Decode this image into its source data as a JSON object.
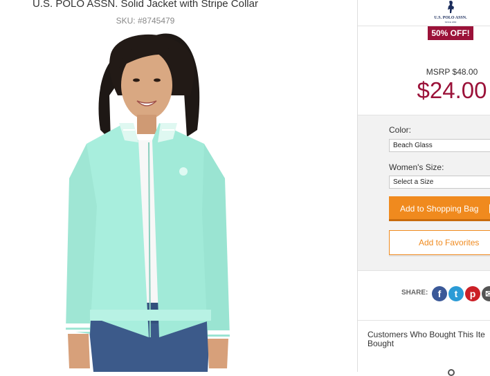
{
  "product": {
    "title": "U.S. POLO ASSN. Solid Jacket with Stripe Collar",
    "sku": "SKU: #8745479",
    "image_alt": "woman-in-mint-jacket-photo"
  },
  "brand": {
    "name": "U.S. POLO ASSN.",
    "tagline": "SINCE 1890"
  },
  "pricing": {
    "discount": "50% OFF!",
    "msrp": "MSRP $48.00",
    "price": "$24.00",
    "accent_color": "#9b1239"
  },
  "options": {
    "color_label": "Color:",
    "color_value": "Beach Glass",
    "size_label": "Women's Size:",
    "size_value": "Select a Size"
  },
  "actions": {
    "add_to_bag": "Add to Shopping Bag",
    "add_to_favorites": "Add to Favorites",
    "button_color": "#f08a1e"
  },
  "share": {
    "label": "SHARE:",
    "networks": [
      "facebook-icon",
      "twitter-icon",
      "pinterest-icon",
      "email-icon"
    ]
  },
  "recommendations": {
    "heading_line1": "Customers Who Bought This Ite",
    "heading_line2": "Bought"
  }
}
